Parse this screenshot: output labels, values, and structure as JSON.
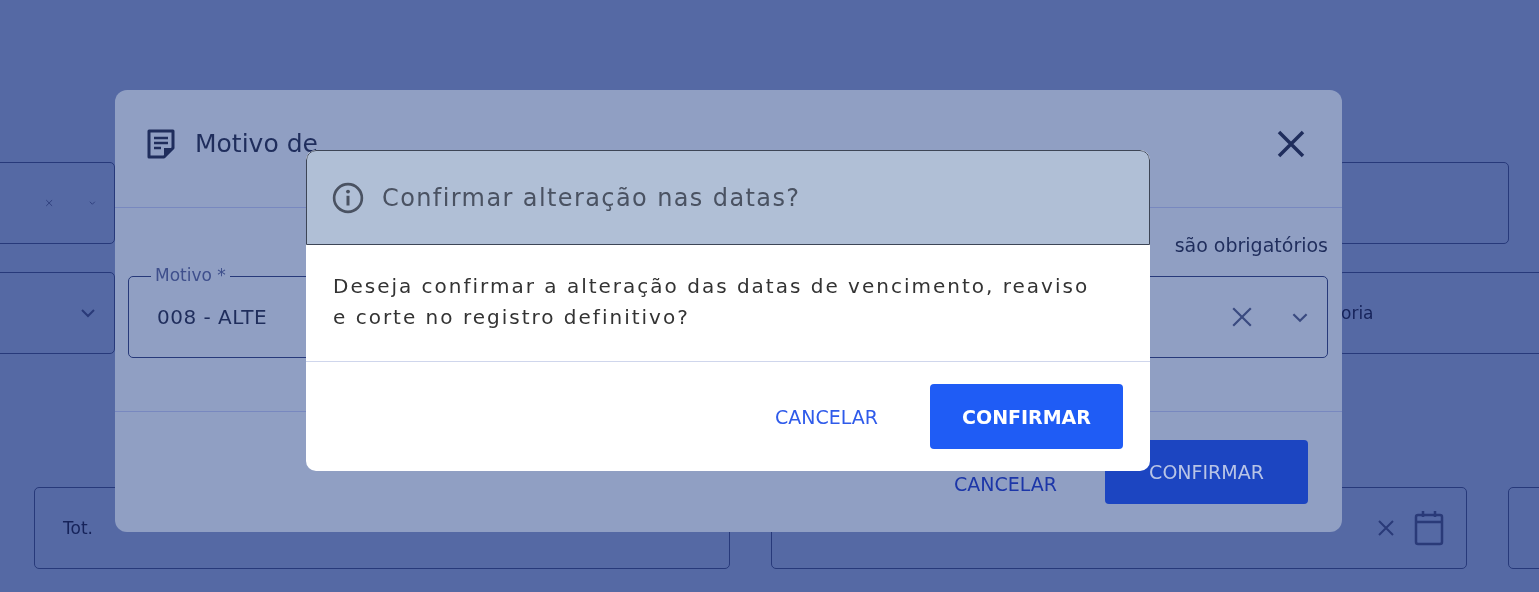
{
  "page_rows": [
    {
      "fields": [
        {
          "kind": "select",
          "clearable": true
        },
        {
          "kind": "text"
        }
      ]
    },
    {
      "fields": [
        {
          "kind": "select",
          "clearable": false
        },
        {
          "kind": "text",
          "placeholder": "oria"
        }
      ]
    },
    {
      "fields": [
        {
          "kind": "text",
          "placeholder": "Tot."
        },
        {
          "kind": "date",
          "clearable": true
        },
        {
          "kind": "text"
        }
      ]
    }
  ],
  "reason_dialog": {
    "title": "Motivo de",
    "required_note": "são obrigatórios",
    "field": {
      "label": "Motivo *",
      "value": "008 - ALTE",
      "clearable": true
    },
    "buttons": [
      {
        "label": "CANCELAR",
        "kind": "text"
      },
      {
        "label": "CONFIRMAR",
        "kind": "primary"
      }
    ]
  },
  "confirm_dialog": {
    "title": "Confirmar alteração nas datas?",
    "message": "Deseja confirmar a alteração das datas de vencimento, reaviso e corte no registro definitivo?",
    "buttons": [
      {
        "label": "CANCELAR",
        "kind": "text"
      },
      {
        "label": "CONFIRMAR",
        "kind": "primary"
      }
    ]
  }
}
